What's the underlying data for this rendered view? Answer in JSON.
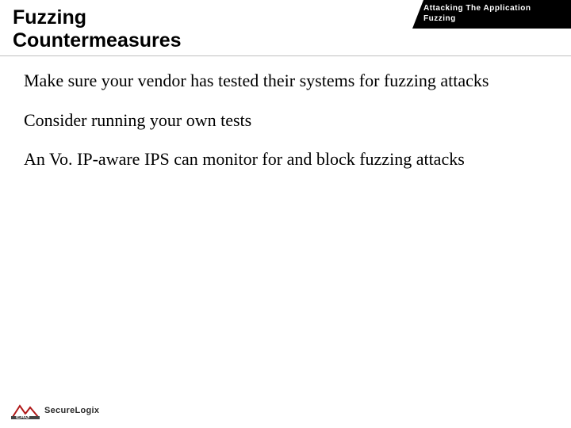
{
  "header_tab": {
    "line1": "Attacking The Application",
    "line2": "Fuzzing"
  },
  "title": {
    "line1": "Fuzzing",
    "line2": "Countermeasures"
  },
  "bullets": [
    "Make sure your vendor has tested their systems for fuzzing attacks",
    "Consider running your own tests",
    "An Vo. IP-aware IPS can monitor for and block fuzzing attacks"
  ],
  "footer": {
    "brand": "SecureLogix",
    "sub": ""
  }
}
